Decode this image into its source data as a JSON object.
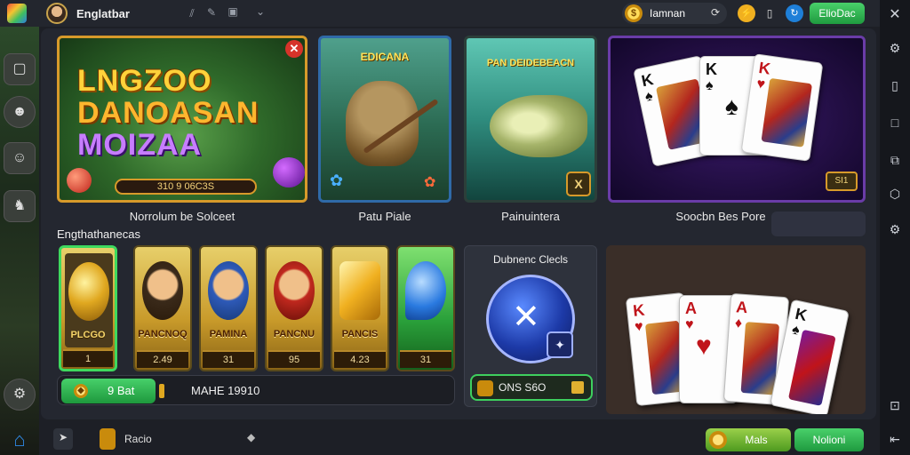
{
  "header": {
    "app_title": "Englatbar",
    "coins_label": "Iamnan",
    "top_button": "ElioDac"
  },
  "featured": {
    "title_line1": "LNGZOO",
    "title_line2": "DANOASAN",
    "title_line3": "MOIZAA",
    "bar_text": "310 9 06C3S",
    "caption": "Norrolum be Solceet"
  },
  "tiles": [
    {
      "label": "EDICANA",
      "caption": "Patu Piale"
    },
    {
      "label": "PAN DEIDEBEACN",
      "caption": "Painuintera"
    },
    {
      "badge": "SI1",
      "caption": "Soocbn Bes Pore"
    }
  ],
  "section_label": "Engthathanecas",
  "items": [
    {
      "label": "PLCGO",
      "count": "1"
    },
    {
      "label": "PANCNOQ",
      "count": "2.49"
    },
    {
      "label": "PAMINA",
      "count": "31"
    },
    {
      "label": "PANCNU",
      "count": "95"
    },
    {
      "label": "PANCIS",
      "count": "4.23"
    },
    {
      "label": "",
      "count": "31"
    }
  ],
  "claim": {
    "button_label": "9 Bat",
    "progress_text": "MAHE 19910"
  },
  "tournament": {
    "title": "Dubnenc Clecls",
    "button_label": "ONS S6O"
  },
  "statusbar": {
    "left_label": "Racio",
    "btn1": "Mals",
    "btn2": "Nolioni"
  },
  "colors": {
    "accent_green": "#2fb34f",
    "gold": "#d79a2a",
    "purple": "#6a3ca8"
  }
}
